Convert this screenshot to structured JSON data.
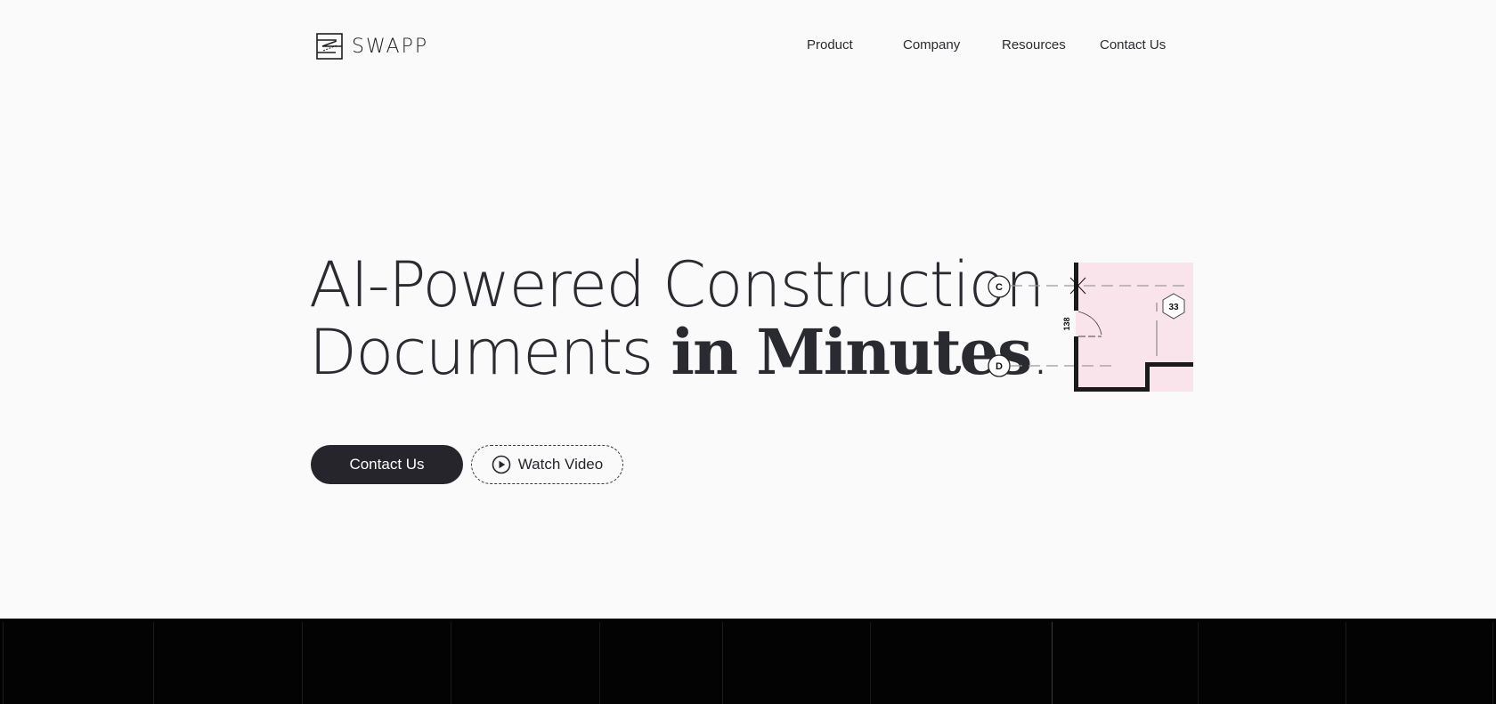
{
  "header": {
    "logo_text": "SWAPP",
    "logo_icon": "swapp-logo-icon",
    "nav": [
      {
        "label": "Product"
      },
      {
        "label": "Company"
      },
      {
        "label": "Resources"
      },
      {
        "label": "Contact Us"
      }
    ]
  },
  "hero": {
    "title_line1": "AI-Powered Construction",
    "title_line2_light": "Documents ",
    "title_line2_serif": "in Minutes",
    "title_line2_end": ".",
    "primary_button": "Contact Us",
    "secondary_button": "Watch Video",
    "secondary_icon": "play-circle-icon"
  },
  "drawing": {
    "grid_labels": [
      "C",
      "D"
    ],
    "dimension_label": "138",
    "room_tag": "33",
    "room_fill": "#f8e4ea"
  },
  "colors": {
    "background": "#fafafa",
    "text": "#25252b",
    "dark_band": "#030303"
  }
}
